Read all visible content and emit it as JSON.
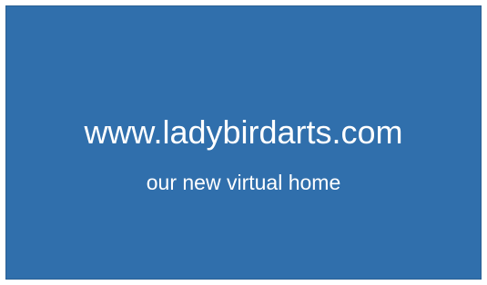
{
  "slide": {
    "url_text": "www.ladybirdarts.com",
    "tagline": "our new virtual home"
  },
  "colors": {
    "background": "#306fac",
    "text": "#ffffff"
  }
}
